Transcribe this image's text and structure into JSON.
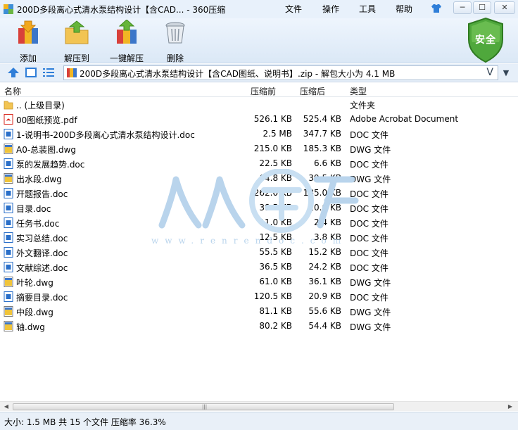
{
  "window": {
    "title": "200D多段离心式清水泵结构设计【含CAD... - 360压缩",
    "menu": [
      "文件",
      "操作",
      "工具",
      "帮助"
    ],
    "controls": {
      "minimize": "─",
      "maximize": "☐",
      "close": "✕"
    }
  },
  "toolbar": {
    "add_label": "添加",
    "extract_to_label": "解压到",
    "one_click_extract_label": "一键解压",
    "delete_label": "删除",
    "safety_badge": "安全"
  },
  "address": {
    "path": "200D多段离心式清水泵结构设计【含CAD图纸、说明书】.zip - 解包大小为 4.1 MB",
    "suffix": "V"
  },
  "list": {
    "columns": [
      "名称",
      "压缩前",
      "压缩后",
      "类型"
    ],
    "rows": [
      {
        "name": ".. (上级目录)",
        "size": "",
        "csize": "",
        "type": "文件夹",
        "icon": "folder"
      },
      {
        "name": "00图纸预览.pdf",
        "size": "526.1 KB",
        "csize": "525.4 KB",
        "type": "Adobe Acrobat Document",
        "icon": "pdf"
      },
      {
        "name": "1-说明书-200D多段离心式清水泵结构设计.doc",
        "size": "2.5 MB",
        "csize": "347.7 KB",
        "type": "DOC 文件",
        "icon": "doc"
      },
      {
        "name": "A0-总装图.dwg",
        "size": "215.0 KB",
        "csize": "185.3 KB",
        "type": "DWG 文件",
        "icon": "dwg"
      },
      {
        "name": "泵的发展趋势.doc",
        "size": "22.5 KB",
        "csize": "6.6 KB",
        "type": "DOC 文件",
        "icon": "doc"
      },
      {
        "name": "出水段.dwg",
        "size": "64.8 KB",
        "csize": "39.5 KB",
        "type": "DWG 文件",
        "icon": "dwg"
      },
      {
        "name": "开题报告.doc",
        "size": "262.0 KB",
        "csize": "185.0 KB",
        "type": "DOC 文件",
        "icon": "doc"
      },
      {
        "name": "目录.doc",
        "size": "38.5 KB",
        "csize": "10.0 KB",
        "type": "DOC 文件",
        "icon": "doc"
      },
      {
        "name": "任务书.doc",
        "size": "11.0 KB",
        "csize": "2.4 KB",
        "type": "DOC 文件",
        "icon": "doc"
      },
      {
        "name": "实习总结.doc",
        "size": "12.5 KB",
        "csize": "3.8 KB",
        "type": "DOC 文件",
        "icon": "doc"
      },
      {
        "name": "外文翻译.doc",
        "size": "55.5 KB",
        "csize": "15.2 KB",
        "type": "DOC 文件",
        "icon": "doc"
      },
      {
        "name": "文献综述.doc",
        "size": "36.5 KB",
        "csize": "24.2 KB",
        "type": "DOC 文件",
        "icon": "doc"
      },
      {
        "name": "叶轮.dwg",
        "size": "61.0 KB",
        "csize": "36.1 KB",
        "type": "DWG 文件",
        "icon": "dwg"
      },
      {
        "name": "摘要目录.doc",
        "size": "120.5 KB",
        "csize": "20.9 KB",
        "type": "DOC 文件",
        "icon": "doc"
      },
      {
        "name": "中段.dwg",
        "size": "81.1 KB",
        "csize": "55.6 KB",
        "type": "DWG 文件",
        "icon": "dwg"
      },
      {
        "name": "轴.dwg",
        "size": "80.2 KB",
        "csize": "54.4 KB",
        "type": "DWG 文件",
        "icon": "dwg"
      }
    ]
  },
  "watermark": {
    "text": "www.renrendoc.com"
  },
  "status": {
    "text": "大小: 1.5 MB 共 15 个文件 压缩率 36.3%"
  },
  "colors": {
    "accent": "#2a6fc9",
    "shield": "#4fa83c",
    "pdf": "#d9251c"
  }
}
